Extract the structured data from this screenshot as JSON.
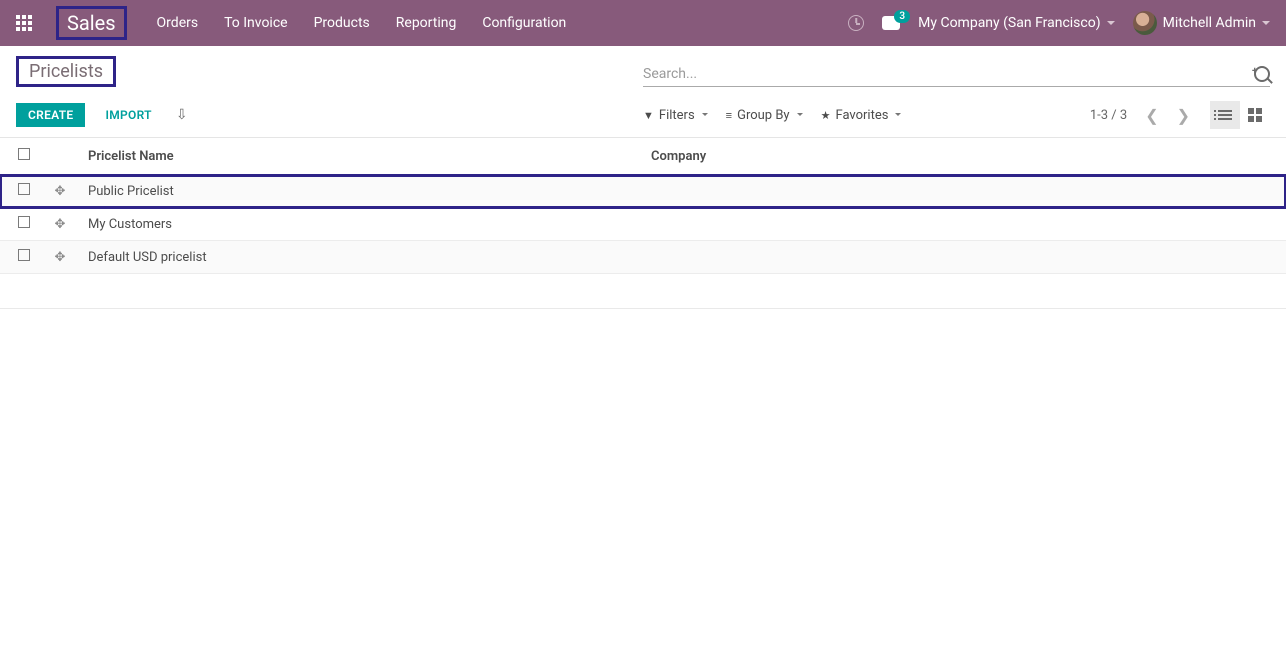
{
  "topbar": {
    "brand": "Sales",
    "nav": [
      "Orders",
      "To Invoice",
      "Products",
      "Reporting",
      "Configuration"
    ],
    "messages_badge": "3",
    "company": "My Company (San Francisco)",
    "user": "Mitchell Admin"
  },
  "breadcrumb": "Pricelists",
  "buttons": {
    "create": "CREATE",
    "import": "IMPORT"
  },
  "search": {
    "placeholder": "Search..."
  },
  "filters": {
    "filters": "Filters",
    "group_by": "Group By",
    "favorites": "Favorites"
  },
  "pager": {
    "text": "1-3 / 3"
  },
  "table": {
    "columns": {
      "name": "Pricelist Name",
      "company": "Company"
    },
    "rows": [
      {
        "name": "Public Pricelist",
        "company": ""
      },
      {
        "name": "My Customers",
        "company": ""
      },
      {
        "name": "Default USD pricelist",
        "company": ""
      }
    ]
  }
}
